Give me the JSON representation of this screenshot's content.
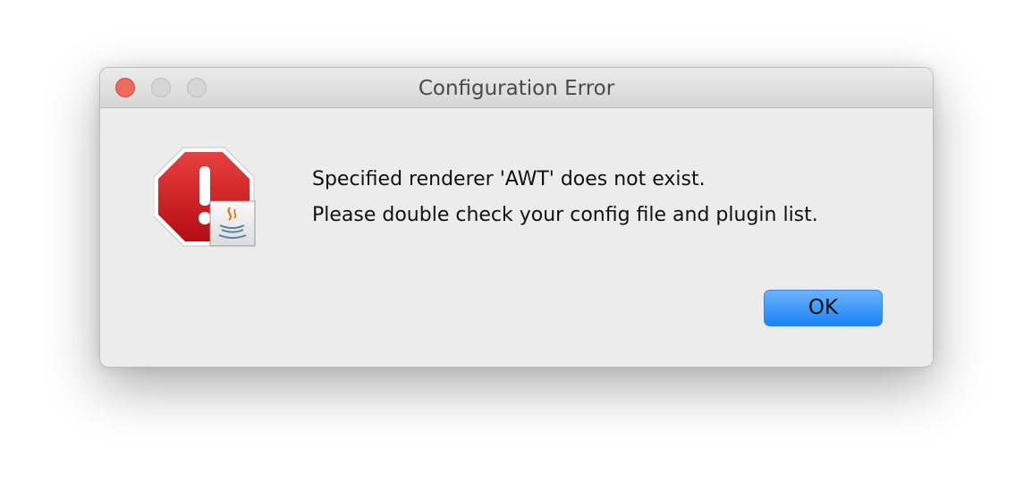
{
  "window": {
    "title": "Configuration Error"
  },
  "traffic_lights": {
    "close_color": "#ed6a5e",
    "minimize_color": "#d5d5d5",
    "zoom_color": "#d5d5d5"
  },
  "dialog": {
    "icon": "stop-sign-error-icon",
    "badge_icon": "java-coffee-cup-icon",
    "message_lines": [
      "Specified renderer 'AWT' does not exist.",
      "Please double check your config file and plugin list."
    ],
    "ok_label": "OK"
  },
  "colors": {
    "stop_sign": "#d0191c",
    "button_accent": "#1a82fb"
  }
}
